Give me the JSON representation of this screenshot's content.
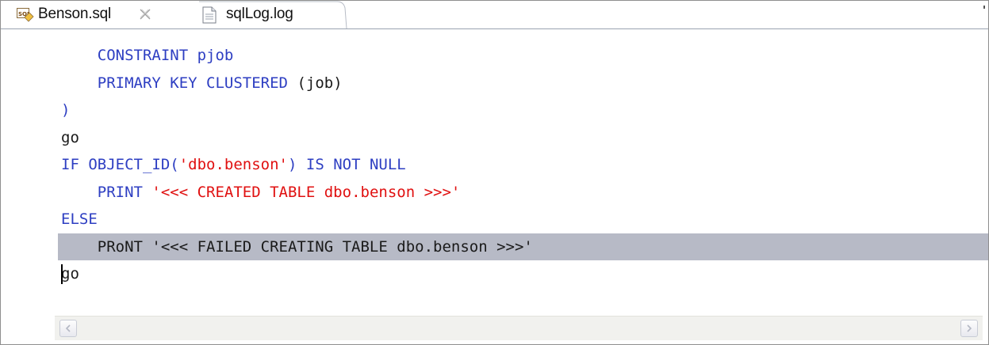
{
  "tabs": [
    {
      "label": "Benson.sql",
      "icon": "sql-file-icon",
      "active": true,
      "closable": true
    },
    {
      "label": "sqlLog.log",
      "icon": "log-file-icon",
      "active": false,
      "closable": false
    }
  ],
  "editor": {
    "lines": [
      {
        "indent": "    ",
        "segments": [
          {
            "t": "CONSTRAINT pjob",
            "c": "kw"
          }
        ]
      },
      {
        "indent": "    ",
        "segments": [
          {
            "t": "PRIMARY KEY CLUSTERED ",
            "c": "kw"
          },
          {
            "t": "(job)",
            "c": "plain"
          }
        ]
      },
      {
        "indent": "",
        "segments": [
          {
            "t": ")",
            "c": "kw"
          }
        ]
      },
      {
        "indent": "",
        "segments": [
          {
            "t": "go",
            "c": "plain"
          }
        ]
      },
      {
        "indent": "",
        "segments": [
          {
            "t": "IF OBJECT_ID(",
            "c": "kw"
          },
          {
            "t": "'dbo.benson'",
            "c": "str"
          },
          {
            "t": ") IS NOT NULL",
            "c": "kw"
          }
        ]
      },
      {
        "indent": "    ",
        "segments": [
          {
            "t": "PRINT ",
            "c": "kw"
          },
          {
            "t": "'<<< CREATED TABLE dbo.benson >>>'",
            "c": "str"
          }
        ]
      },
      {
        "indent": "",
        "segments": [
          {
            "t": "ELSE",
            "c": "kw"
          }
        ]
      },
      {
        "indent": "    ",
        "segments": [
          {
            "t": "PRoNT '<<< FAILED CREATING TABLE dbo.benson >>>'",
            "c": "plain"
          }
        ],
        "highlight": true
      },
      {
        "indent": "",
        "segments": [
          {
            "t": "go",
            "c": "plain"
          }
        ],
        "caret": true
      }
    ]
  },
  "colors": {
    "keyword": "#2d3ec2",
    "string": "#e01010",
    "plain": "#1a1a1a",
    "current_line": "#b7bac6"
  }
}
